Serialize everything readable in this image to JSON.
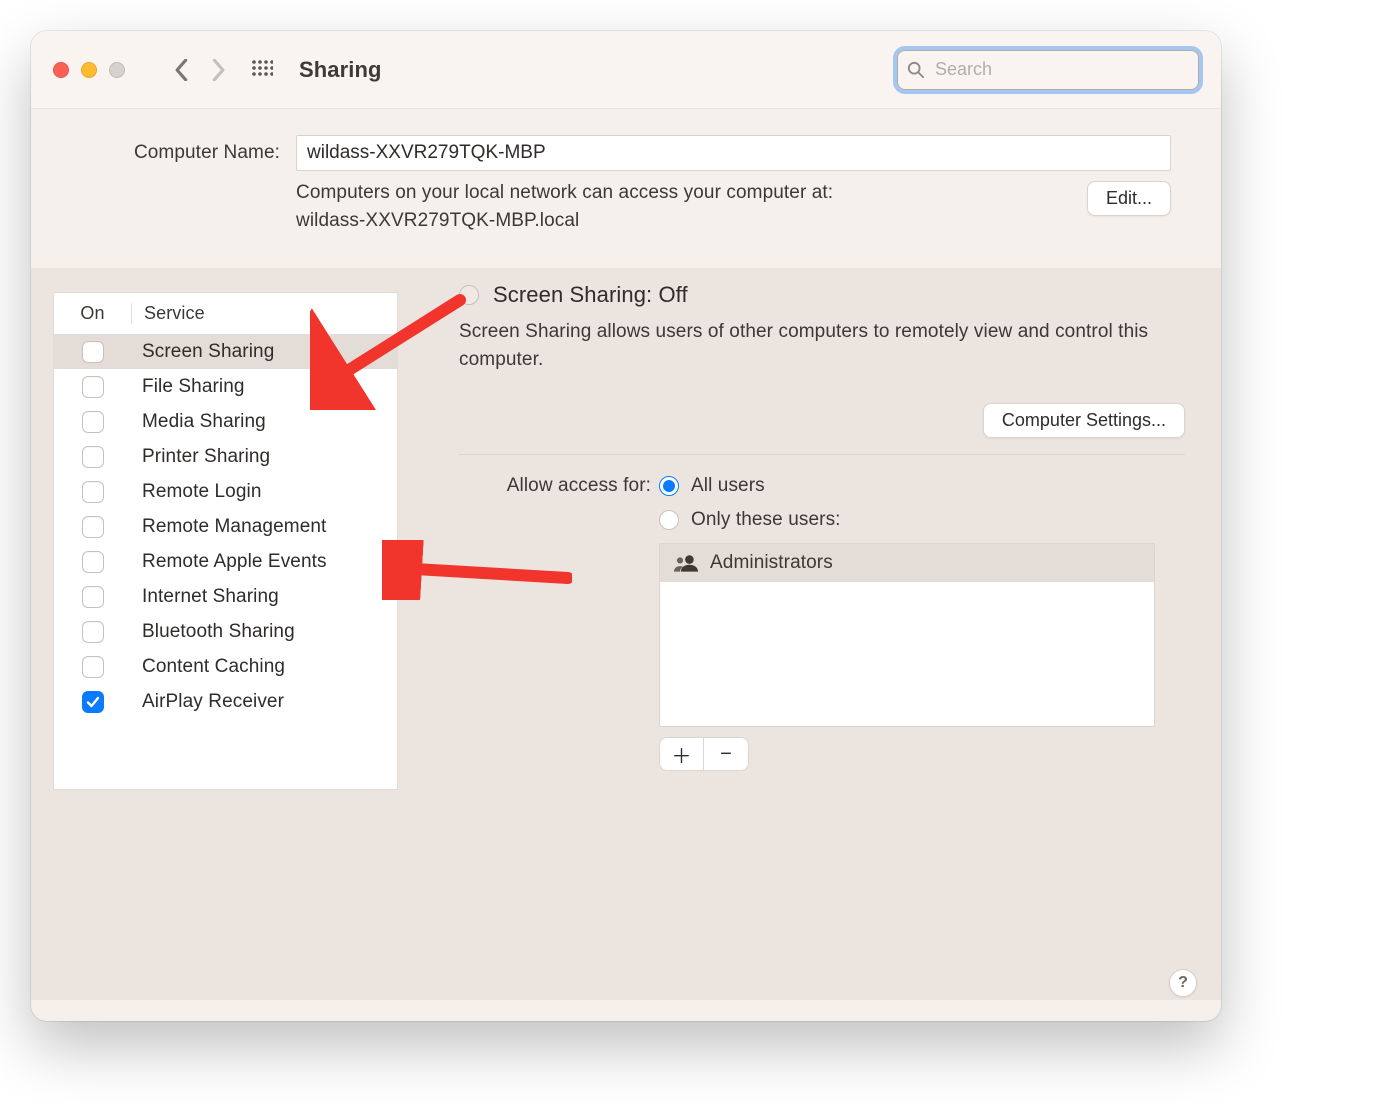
{
  "toolbar": {
    "title": "Sharing",
    "search_placeholder": "Search"
  },
  "computer": {
    "label": "Computer Name:",
    "name": "wildass-XXVR279TQK-MBP",
    "access_line1": "Computers on your local network can access your computer at:",
    "access_line2": "wildass-XXVR279TQK-MBP.local",
    "edit": "Edit..."
  },
  "service_table": {
    "col_on": "On",
    "col_service": "Service",
    "rows": [
      {
        "label": "Screen Sharing",
        "on": false,
        "selected": true
      },
      {
        "label": "File Sharing",
        "on": false,
        "selected": false
      },
      {
        "label": "Media Sharing",
        "on": false,
        "selected": false
      },
      {
        "label": "Printer Sharing",
        "on": false,
        "selected": false
      },
      {
        "label": "Remote Login",
        "on": false,
        "selected": false
      },
      {
        "label": "Remote Management",
        "on": false,
        "selected": false
      },
      {
        "label": "Remote Apple Events",
        "on": false,
        "selected": false
      },
      {
        "label": "Internet Sharing",
        "on": false,
        "selected": false
      },
      {
        "label": "Bluetooth Sharing",
        "on": false,
        "selected": false
      },
      {
        "label": "Content Caching",
        "on": false,
        "selected": false
      },
      {
        "label": "AirPlay Receiver",
        "on": true,
        "selected": false
      }
    ]
  },
  "detail": {
    "heading": "Screen Sharing: Off",
    "description": "Screen Sharing allows users of other computers to remotely view and control this computer.",
    "settings_btn": "Computer Settings...",
    "access_label": "Allow access for:",
    "opt_all": "All users",
    "opt_only": "Only these users:",
    "selected_option": "all",
    "users": [
      "Administrators"
    ]
  }
}
